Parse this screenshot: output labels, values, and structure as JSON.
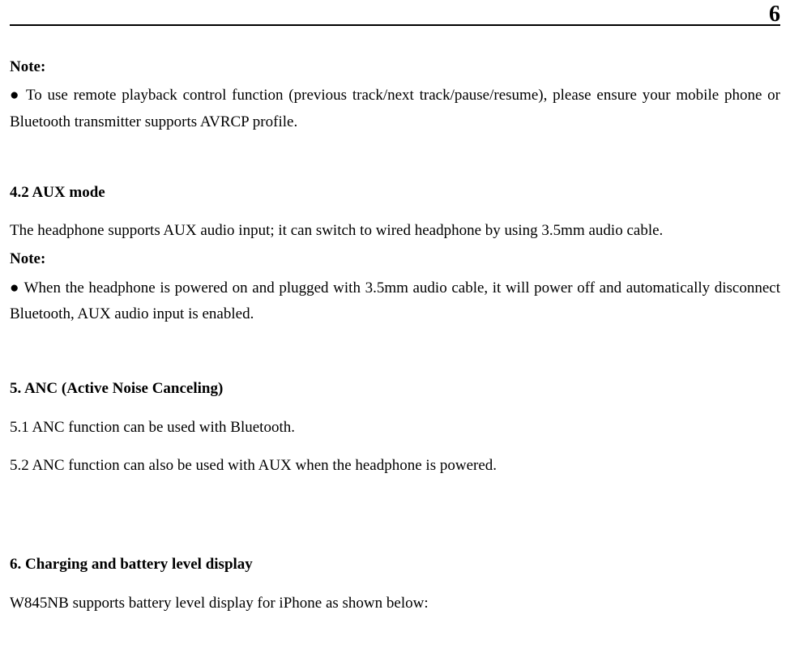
{
  "page_number": "6",
  "note1_label": "Note:",
  "note1_bullet": "● To use remote playback control function (previous track/next track/pause/resume), please ensure your mobile phone or Bluetooth transmitter supports AVRCP profile.",
  "sec42_title": "4.2 AUX mode",
  "sec42_para": "The headphone supports AUX audio input; it can switch to wired headphone by using 3.5mm audio cable.",
  "note2_label": "Note:",
  "note2_bullet": "● When the headphone is powered on and plugged with 3.5mm audio cable, it will power off and automatically disconnect Bluetooth, AUX audio input is enabled.",
  "sec5_title": "5. ANC (Active Noise Canceling)",
  "sec5_1": "5.1 ANC function can be used with Bluetooth.",
  "sec5_2": "5.2 ANC function can also be used with AUX when the headphone is powered.",
  "sec6_title": "6. Charging and battery level display",
  "sec6_para": "W845NB supports battery level display for iPhone as shown below:"
}
